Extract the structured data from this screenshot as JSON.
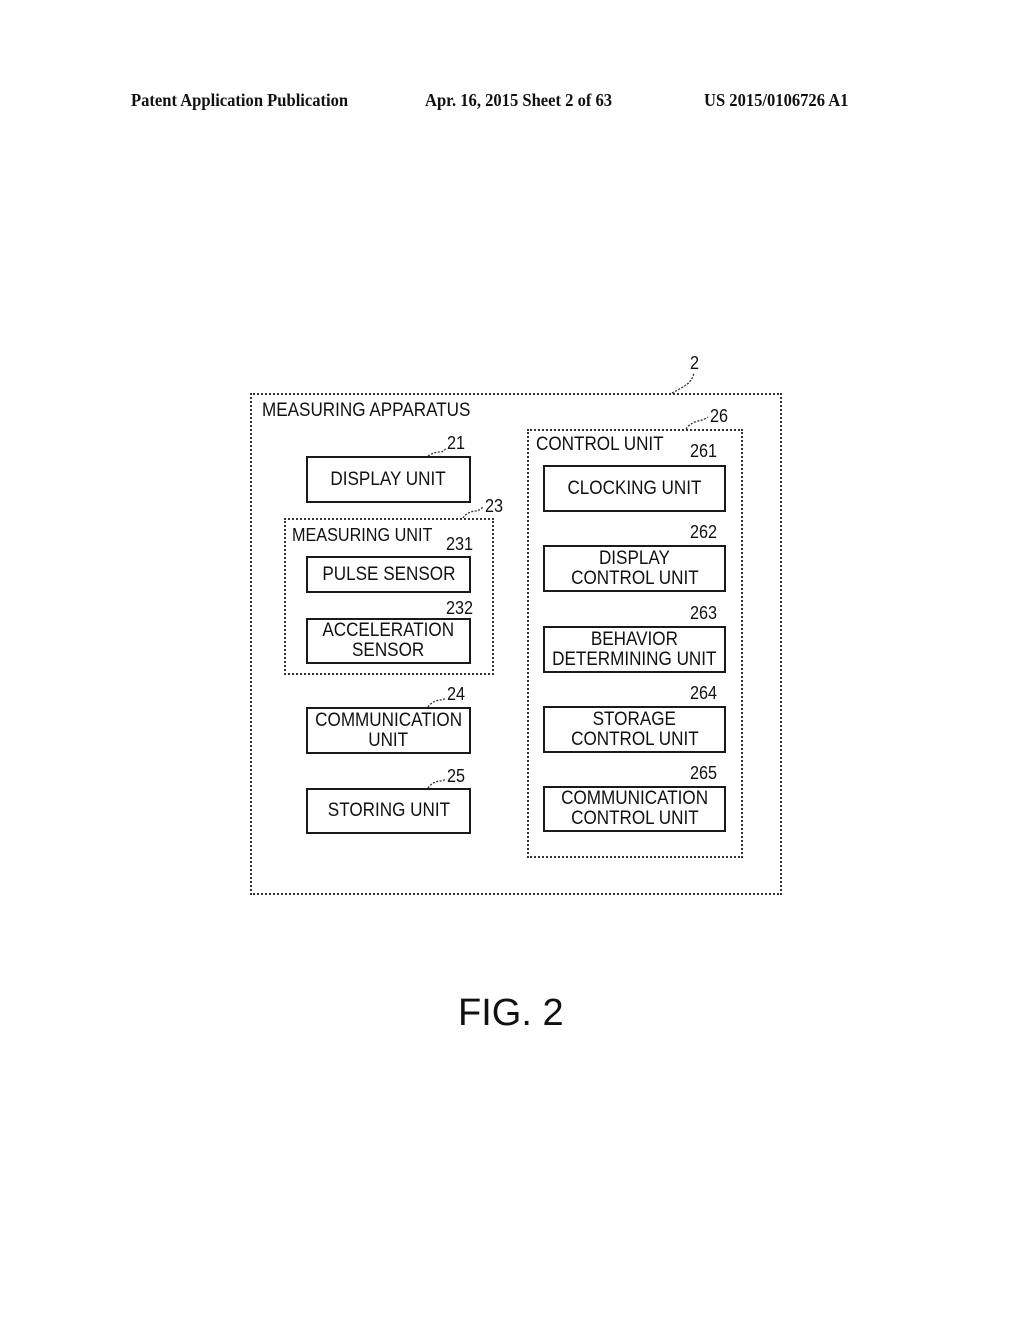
{
  "header": {
    "publication": "Patent Application Publication",
    "date_sheet": "Apr. 16, 2015  Sheet 2 of 63",
    "patent_number": "US 2015/0106726 A1"
  },
  "diagram": {
    "apparatus": {
      "label": "MEASURING APPARATUS",
      "ref": "2"
    },
    "display_unit": {
      "label": "DISPLAY UNIT",
      "ref": "21"
    },
    "measuring_unit": {
      "label": "MEASURING UNIT",
      "ref": "23",
      "pulse_sensor": {
        "label": "PULSE SENSOR",
        "ref": "231"
      },
      "acceleration_sensor": {
        "line1": "ACCELERATION",
        "line2": "SENSOR",
        "ref": "232"
      }
    },
    "communication_unit": {
      "line1": "COMMUNICATION",
      "line2": "UNIT",
      "ref": "24"
    },
    "storing_unit": {
      "label": "STORING UNIT",
      "ref": "25"
    },
    "control_unit": {
      "label": "CONTROL UNIT",
      "ref": "26",
      "clocking_unit": {
        "label": "CLOCKING UNIT",
        "ref": "261"
      },
      "display_control_unit": {
        "line1": "DISPLAY",
        "line2": "CONTROL UNIT",
        "ref": "262"
      },
      "behavior_determining_unit": {
        "line1": "BEHAVIOR",
        "line2": "DETERMINING UNIT",
        "ref": "263"
      },
      "storage_control_unit": {
        "line1": "STORAGE",
        "line2": "CONTROL UNIT",
        "ref": "264"
      },
      "communication_control_unit": {
        "line1": "COMMUNICATION",
        "line2": "CONTROL UNIT",
        "ref": "265"
      }
    }
  },
  "figure_caption": "FIG. 2"
}
